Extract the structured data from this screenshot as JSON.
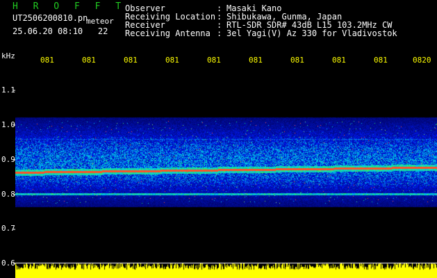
{
  "header": {
    "app_title": "H R O F F T",
    "filename": "UT2506200810.pn",
    "meteor_label": "meteor",
    "date": "25.06.20",
    "time": "08:10",
    "count": "22"
  },
  "info": [
    {
      "label": "Observer",
      "value": "Masaki Kano"
    },
    {
      "label": "Receiving Location",
      "value": "Shibukawa, Gunma, Japan"
    },
    {
      "label": "Receiver",
      "value": "RTL-SDR SDR# 43dB L15 103.2MHz CW"
    },
    {
      "label": "Receiving Antenna",
      "value": "3el Yagi(V) Az 330 for Vladivostok"
    }
  ],
  "axis": {
    "y_unit": "kHz",
    "y_ticks": [
      "1.1",
      "1.0",
      "0.9",
      "0.8",
      "0.7",
      "0.6"
    ],
    "x_ticks": [
      "081",
      "081",
      "081",
      "081",
      "081",
      "081",
      "081",
      "081",
      "081",
      "0820"
    ]
  },
  "colors": {
    "title": "#22cc22",
    "tick_y": "#ffffff",
    "tick_x": "#ffff00",
    "power": "#ffff00",
    "background": "#000000"
  }
}
